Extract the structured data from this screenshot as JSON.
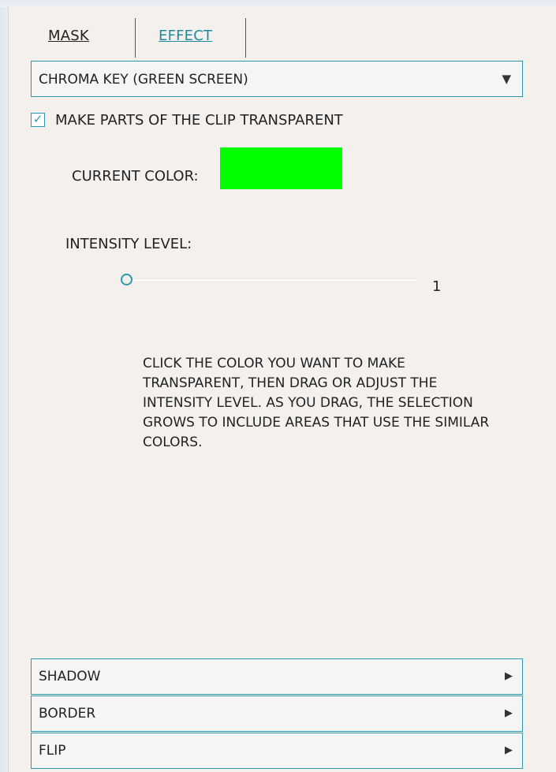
{
  "tabs": {
    "mask": "MASK",
    "effect": "EFFECT"
  },
  "mask_type": {
    "selected": "CHROMA KEY (GREEN SCREEN)",
    "arrow": "▼"
  },
  "transparency": {
    "checked": true,
    "check_glyph": "✓",
    "label": "MAKE PARTS OF THE CLIP TRANSPARENT"
  },
  "current_color": {
    "label": "CURRENT COLOR:",
    "value": "#00ff00"
  },
  "intensity": {
    "label": "INTENSITY LEVEL:",
    "value": "1",
    "fraction": 0.0
  },
  "instructions": "CLICK THE COLOR YOU WANT TO MAKE TRANSPARENT, THEN DRAG OR ADJUST THE INTENSITY LEVEL. AS YOU DRAG, THE SELECTION GROWS TO INCLUDE AREAS THAT USE THE SIMILAR COLORS.",
  "sections": {
    "shadow": "SHADOW",
    "border": "BORDER",
    "flip": "FLIP",
    "arrow": "▶"
  },
  "colors": {
    "accent": "#2d9aab",
    "link": "#1e8aa0",
    "background": "#f4f0ed"
  }
}
